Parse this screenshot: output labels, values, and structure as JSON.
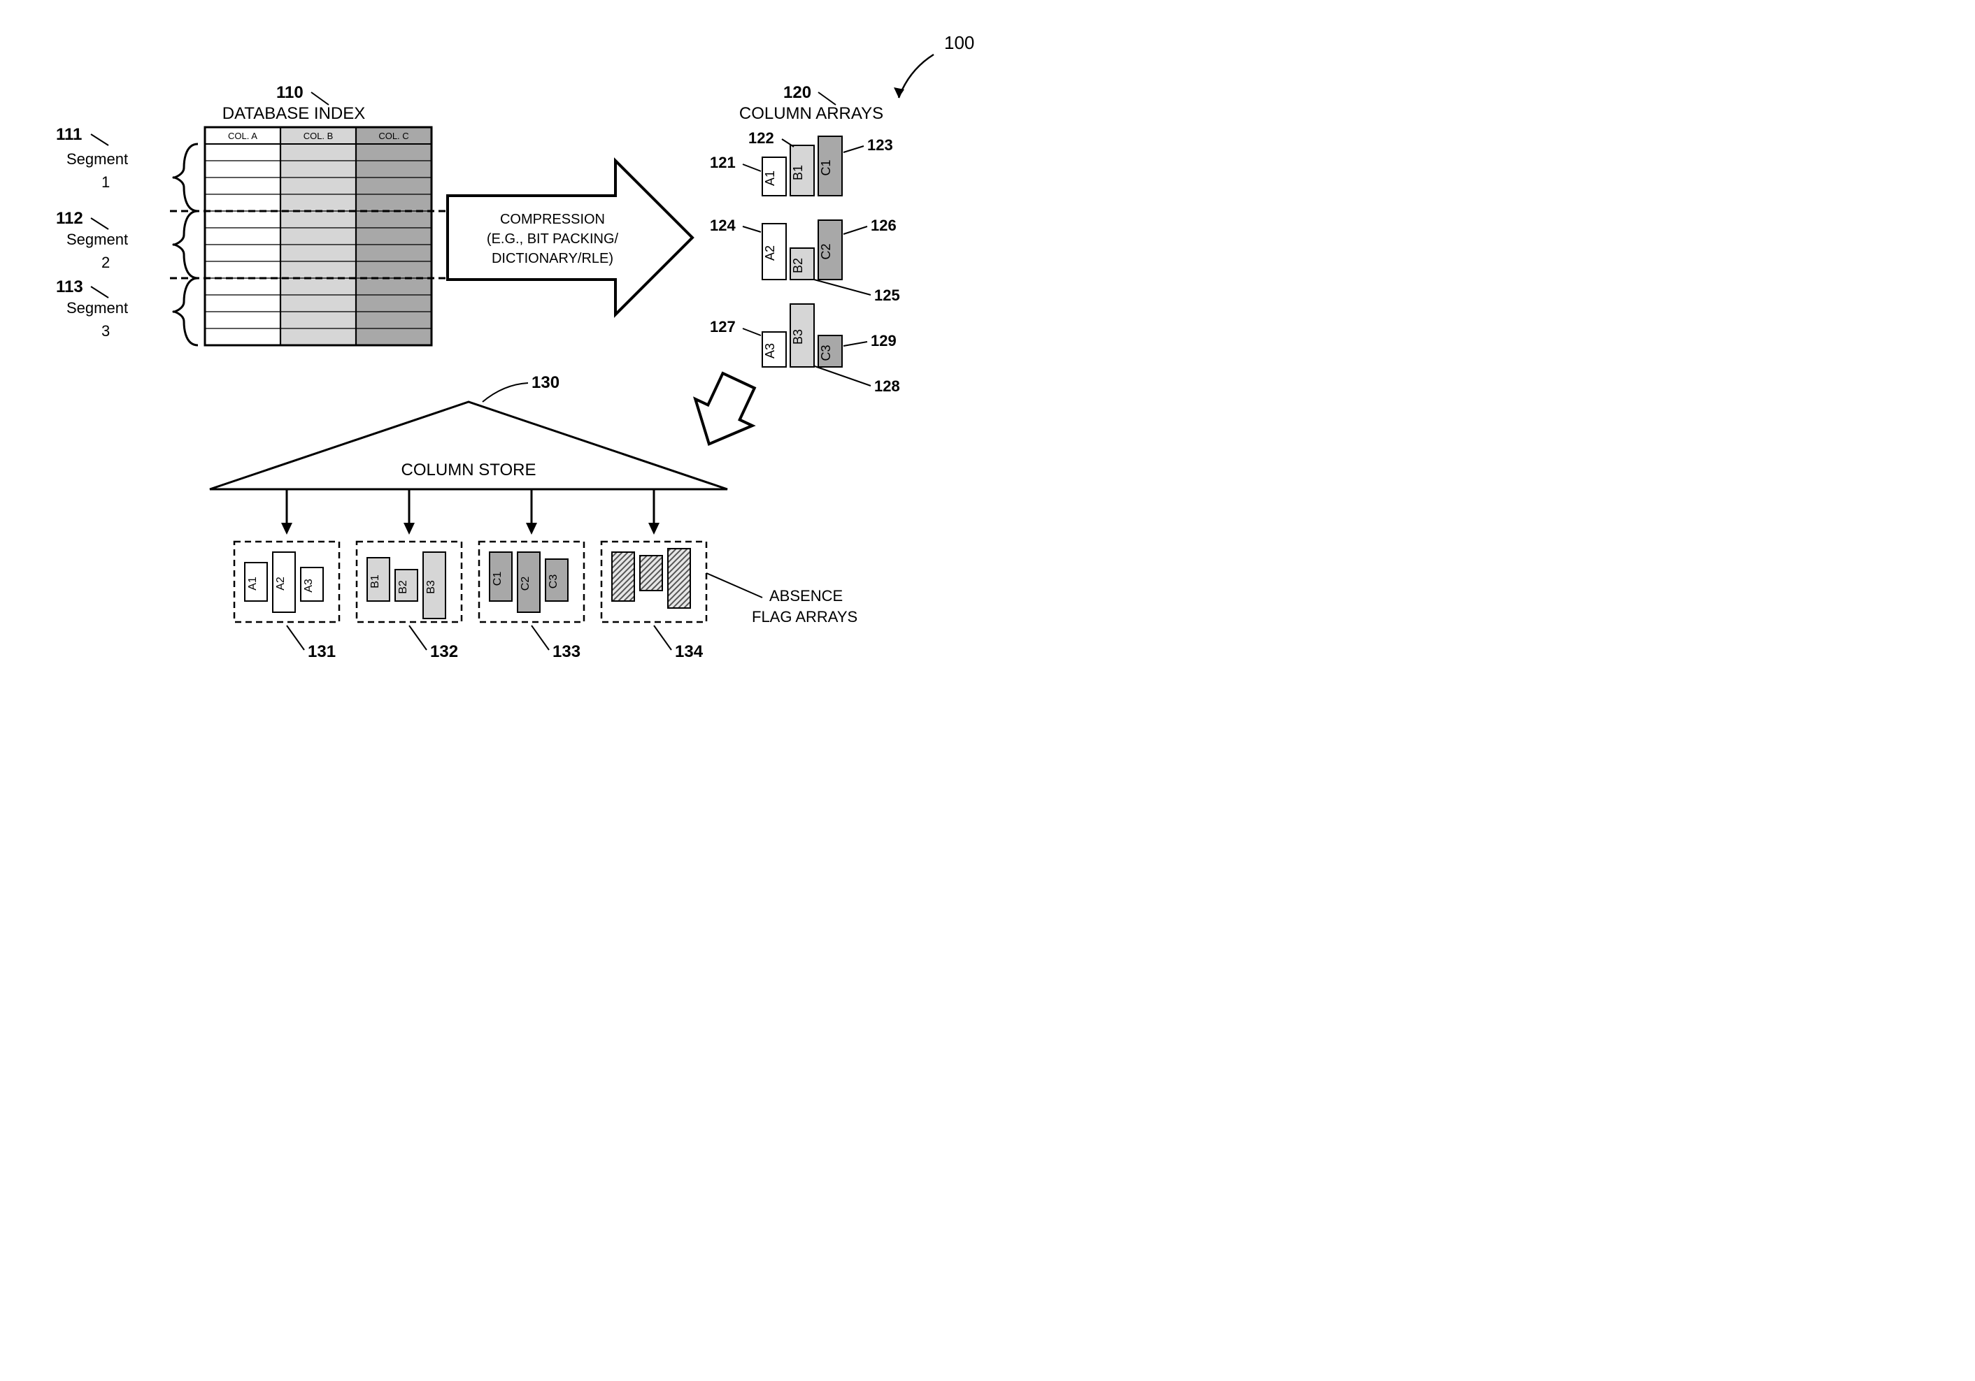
{
  "figure_label": "100",
  "database_index": {
    "ref": "110",
    "title": "DATABASE INDEX",
    "columns": [
      "COL. A",
      "COL. B",
      "COL. C"
    ],
    "segments": [
      {
        "ref": "111",
        "label_top": "Segment",
        "label_bottom": "1"
      },
      {
        "ref": "112",
        "label_top": "Segment",
        "label_bottom": "2"
      },
      {
        "ref": "113",
        "label_top": "Segment",
        "label_bottom": "3"
      }
    ]
  },
  "compression_arrow": {
    "line1": "COMPRESSION",
    "line2": "(E.G., BIT PACKING/",
    "line3": "DICTIONARY/RLE)"
  },
  "column_arrays": {
    "ref": "120",
    "title": "COLUMN ARRAYS",
    "items": {
      "a1": {
        "ref": "121",
        "label": "A1"
      },
      "b1": {
        "ref": "122",
        "label": "B1"
      },
      "c1": {
        "ref": "123",
        "label": "C1"
      },
      "a2": {
        "ref": "124",
        "label": "A2"
      },
      "b2": {
        "ref": "125",
        "label": "B2"
      },
      "c2": {
        "ref": "126",
        "label": "C2"
      },
      "a3": {
        "ref": "127",
        "label": "A3"
      },
      "b3": {
        "ref": "128",
        "label": "B3"
      },
      "c3": {
        "ref": "129",
        "label": "C3"
      }
    }
  },
  "column_store": {
    "ref": "130",
    "title": "COLUMN STORE",
    "groups": [
      {
        "ref": "131",
        "labels": [
          "A1",
          "A2",
          "A3"
        ]
      },
      {
        "ref": "132",
        "labels": [
          "B1",
          "B2",
          "B3"
        ]
      },
      {
        "ref": "133",
        "labels": [
          "C1",
          "C2",
          "C3"
        ]
      },
      {
        "ref": "134",
        "label": "ABSENCE FLAG ARRAYS"
      }
    ]
  },
  "absence_flag_label_line1": "ABSENCE",
  "absence_flag_label_line2": "FLAG ARRAYS"
}
